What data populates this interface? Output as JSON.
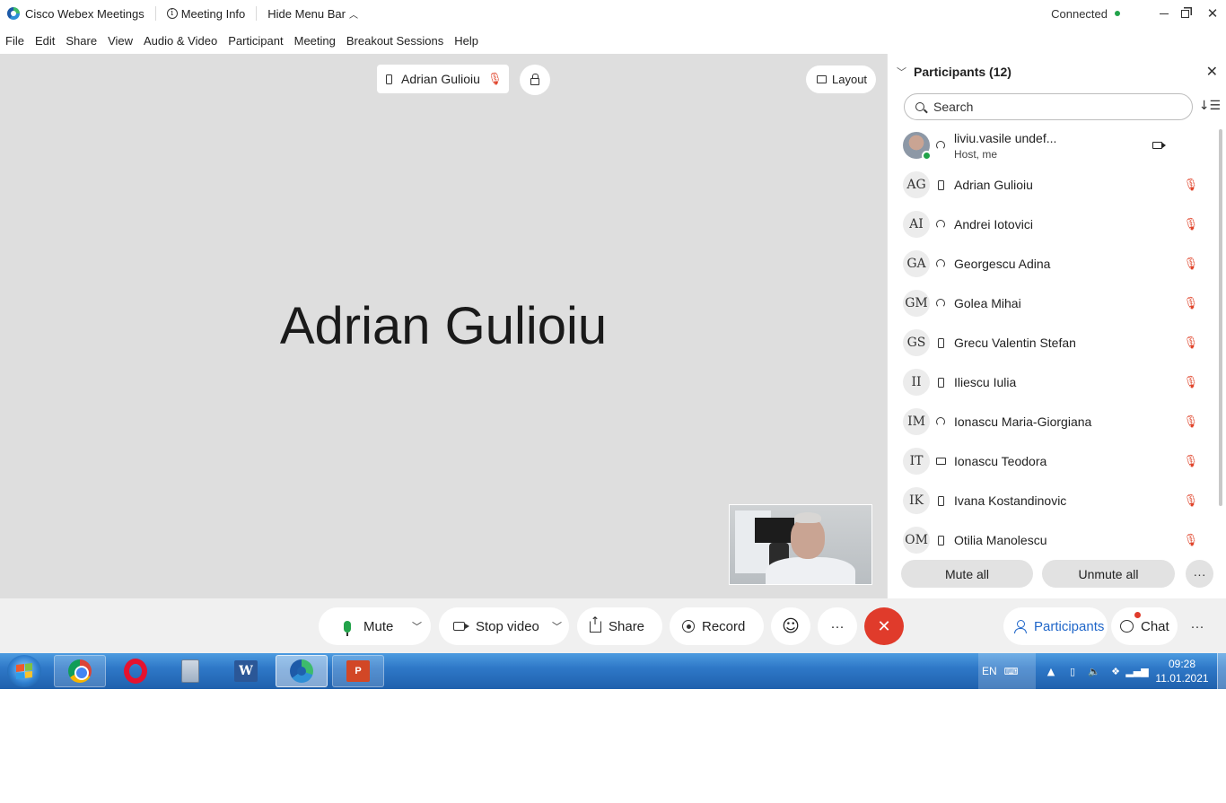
{
  "titlebar": {
    "app_title": "Cisco Webex Meetings",
    "meeting_info": "Meeting Info",
    "hide_menu_bar": "Hide Menu Bar",
    "status": "Connected"
  },
  "menu": [
    "File",
    "Edit",
    "Share",
    "View",
    "Audio & Video",
    "Participant",
    "Meeting",
    "Breakout Sessions",
    "Help"
  ],
  "stage": {
    "active_speaker": "Adrian Gulioiu",
    "layout_label": "Layout",
    "big_name": "Adrian Gulioiu"
  },
  "panel": {
    "title": "Participants (12)",
    "search_placeholder": "Search",
    "host": {
      "initials": "",
      "name": "liviu.vasile undef...",
      "role": "Host, me",
      "audio": "headset"
    },
    "participants": [
      {
        "initials": "AG",
        "name": "Adrian Gulioiu",
        "audio": "phone"
      },
      {
        "initials": "AI",
        "name": "Andrei Iotovici",
        "audio": "headset"
      },
      {
        "initials": "GA",
        "name": "Georgescu Adina",
        "audio": "headset"
      },
      {
        "initials": "GM",
        "name": "Golea Mihai",
        "audio": "headset"
      },
      {
        "initials": "GS",
        "name": "Grecu Valentin Stefan",
        "audio": "phone"
      },
      {
        "initials": "II",
        "name": "Iliescu Iulia",
        "audio": "phone"
      },
      {
        "initials": "IM",
        "name": "Ionascu Maria-Giorgiana",
        "audio": "headset"
      },
      {
        "initials": "IT",
        "name": "Ionascu Teodora",
        "audio": "monitor"
      },
      {
        "initials": "IK",
        "name": "Ivana Kostandinovic",
        "audio": "phone"
      },
      {
        "initials": "OM",
        "name": "Otilia Manolescu",
        "audio": "phone"
      }
    ],
    "mute_all": "Mute all",
    "unmute_all": "Unmute all"
  },
  "controls": {
    "mute": "Mute",
    "stop_video": "Stop video",
    "share": "Share",
    "record": "Record",
    "participants": "Participants",
    "chat": "Chat"
  },
  "taskbar": {
    "apps": [
      "chrome",
      "opera",
      "calculator",
      "word",
      "webex",
      "powerpoint"
    ],
    "active_app": "webex",
    "language": "EN",
    "time": "09:28",
    "date": "11.01.2021"
  },
  "colors": {
    "accent": "#1f66c9",
    "leave": "#e03b2b",
    "muted": "#e0452c",
    "connected": "#22a34a"
  }
}
